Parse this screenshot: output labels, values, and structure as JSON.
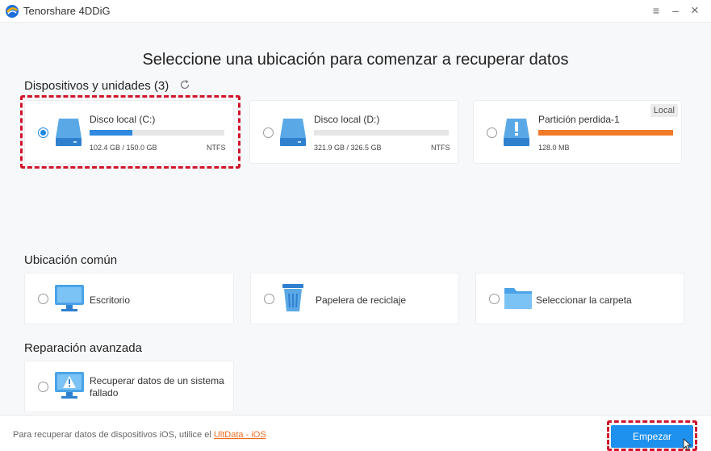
{
  "app": {
    "title": "Tenorshare 4DDiG"
  },
  "window_controls": {
    "menu": "≡",
    "minimize": "–",
    "close": "×"
  },
  "page_title": "Seleccione una ubicación para comenzar a recuperar datos",
  "devices": {
    "heading": "Dispositivos y unidades (3)",
    "items": [
      {
        "name": "Disco local (C:)",
        "size": "102.4 GB / 150.0 GB",
        "fs": "NTFS",
        "used_fraction": 0.32,
        "bar_color": "#2f8ae0",
        "selected": true
      },
      {
        "name": "Disco local (D:)",
        "size": "321.9 GB / 326.5 GB",
        "fs": "NTFS",
        "used_fraction": 0.0,
        "bar_color": "#2f8ae0",
        "selected": false
      },
      {
        "name": "Partición perdida-1",
        "size": "128.0 MB",
        "fs": "",
        "used_fraction": 1.0,
        "bar_color": "#f07a2a",
        "badge": "Local",
        "selected": false
      }
    ]
  },
  "common": {
    "heading": "Ubicación común",
    "items": [
      {
        "label": "Escritorio",
        "icon": "desktop-icon"
      },
      {
        "label": "Papelera de reciclaje",
        "icon": "recycle-bin-icon"
      },
      {
        "label": "Seleccionar la carpeta",
        "icon": "folder-icon"
      }
    ]
  },
  "advanced": {
    "heading": "Reparación avanzada",
    "items": [
      {
        "label_line1": "Recuperar datos de un sistema",
        "label_line2": "fallado",
        "icon": "crashed-system-icon"
      }
    ]
  },
  "footer": {
    "text": "Para recuperar datos de dispositivos iOS, utilice el",
    "link": "UltData - iOS",
    "start_button": "Empezar"
  },
  "colors": {
    "accent": "#1e90ee",
    "highlight": "#d0152a",
    "link": "#f26b1d"
  }
}
